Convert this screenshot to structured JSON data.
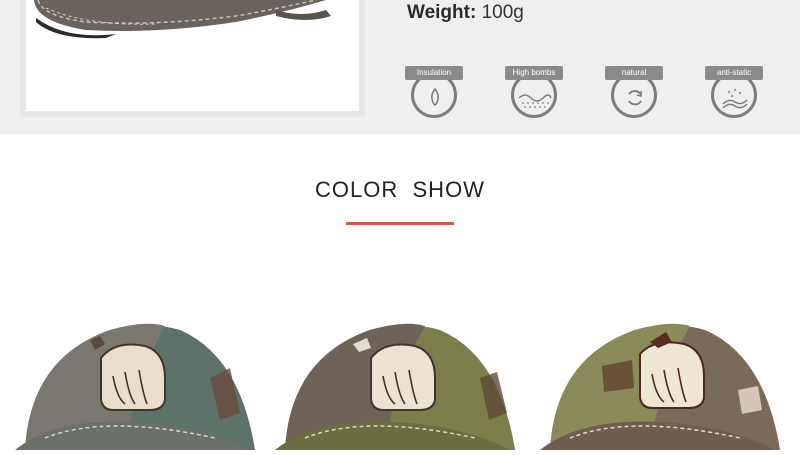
{
  "spec": {
    "weight_label": "Weight:",
    "weight_value": "100g"
  },
  "features": [
    {
      "label": "Insulation",
      "icon": "insulation-icon"
    },
    {
      "label": "High bombs",
      "icon": "breathable-icon"
    },
    {
      "label": "natural",
      "icon": "natural-icon"
    },
    {
      "label": "anti-static",
      "icon": "anti-static-icon"
    }
  ],
  "section": {
    "title": "COLOR  SHOW"
  },
  "colors": {
    "accent": "#d9534f",
    "band": "#efefef"
  },
  "color_variants": [
    {
      "name": "grey-green cap",
      "crown": "#7a7670",
      "side": "#5d7268",
      "bill": "#6b6f6a"
    },
    {
      "name": "brown-olive cap",
      "crown": "#6e6358",
      "side": "#7b7d4a",
      "bill": "#6a6d40"
    },
    {
      "name": "olive-brown cap",
      "crown": "#8a8a5a",
      "side": "#7a6a5a",
      "bill": "#6f5e4f"
    }
  ]
}
